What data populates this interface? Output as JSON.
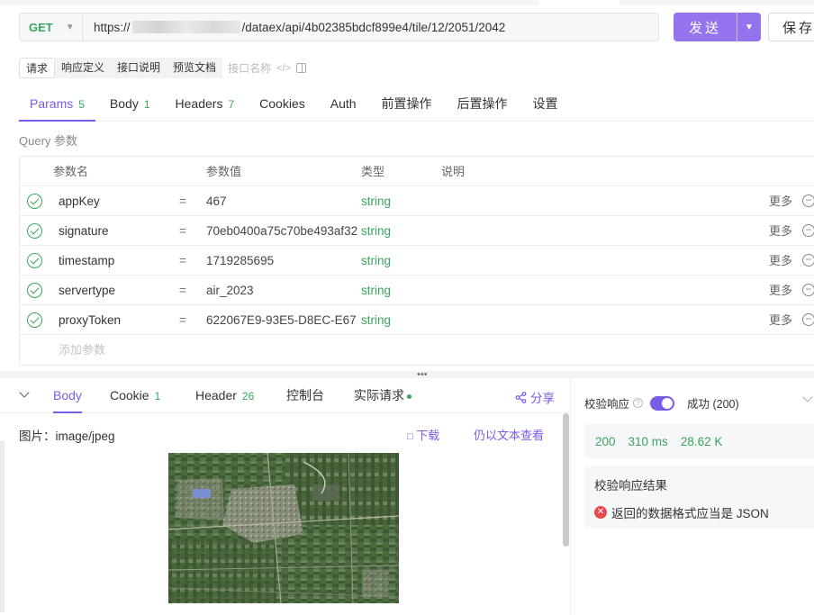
{
  "request": {
    "method": "GET",
    "url_prefix": "https://",
    "url_suffix": "/dataex/api/4b02385bdcf899e4/tile/12/2051/2042",
    "send_label": "发送",
    "save_label": "保存"
  },
  "subtabs": [
    "请求",
    "响应定义",
    "接口说明",
    "预览文档"
  ],
  "api_name_placeholder": "接口名称",
  "tabs": [
    {
      "label": "Params",
      "count": "5"
    },
    {
      "label": "Body",
      "count": "1"
    },
    {
      "label": "Headers",
      "count": "7"
    },
    {
      "label": "Cookies",
      "count": ""
    },
    {
      "label": "Auth",
      "count": ""
    },
    {
      "label": "前置操作",
      "count": ""
    },
    {
      "label": "后置操作",
      "count": ""
    },
    {
      "label": "设置",
      "count": ""
    }
  ],
  "query_label": "Query 参数",
  "params_header": {
    "name": "参数名",
    "value": "参数值",
    "type": "类型",
    "desc": "说明"
  },
  "params": [
    {
      "name": "appKey",
      "eq": "=",
      "value": "467",
      "type": "string",
      "more": "更多"
    },
    {
      "name": "signature",
      "eq": "=",
      "value": "70eb0400a75c70be493af32",
      "type": "string",
      "more": "更多"
    },
    {
      "name": "timestamp",
      "eq": "=",
      "value": "1719285695",
      "type": "string",
      "more": "更多"
    },
    {
      "name": "servertype",
      "eq": "=",
      "value": "air_2023",
      "type": "string",
      "more": "更多"
    },
    {
      "name": "proxyToken",
      "eq": "=",
      "value": "622067E9-93E5-D8EC-E67",
      "type": "string",
      "more": "更多"
    }
  ],
  "add_param_placeholder": "添加参数",
  "response_tabs": [
    {
      "label": "Body",
      "count": ""
    },
    {
      "label": "Cookie",
      "count": "1"
    },
    {
      "label": "Header",
      "count": "26"
    },
    {
      "label": "控制台",
      "count": ""
    },
    {
      "label": "实际请求",
      "count": ""
    }
  ],
  "share_label": "分享",
  "image_label": "图片：image/jpeg",
  "download_label": "下载",
  "view_as_text_label": "仍以文本查看",
  "verify": {
    "label": "校验响应",
    "status": "成功 (200)",
    "code": "200",
    "time": "310 ms",
    "size": "28.62 K",
    "result_title": "校验响应结果",
    "result_msg": "返回的数据格式应当是 JSON"
  },
  "colors": {
    "accent": "#7b5be8",
    "green": "#3aa55c",
    "error": "#e5484d"
  }
}
